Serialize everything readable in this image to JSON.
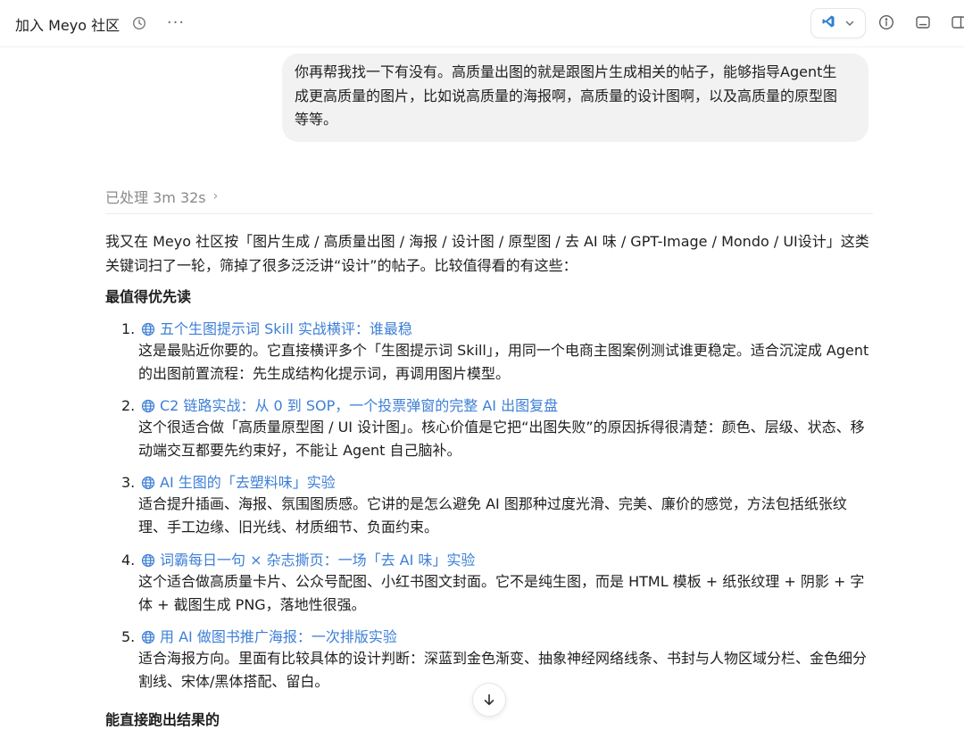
{
  "header": {
    "title": "加入 Meyo 社区",
    "more_label": "···",
    "history_icon": "clock-icon",
    "ide_icon": "vscode-icon"
  },
  "user_message": "你再帮我找一下有没有。高质量出图的就是跟图片生成相关的帖子，能够指导Agent生成更高质量的图片，比如说高质量的海报啊，高质量的设计图啊，以及高质量的原型图等等。",
  "processed": {
    "label": "已处理 3m 32s",
    "chevron": "›"
  },
  "answer": {
    "intro": "我又在 Meyo 社区按「图片生成 / 高质量出图 / 海报 / 设计图 / 原型图 / 去 AI 味 / GPT-Image / Mondo / UI设计」这类关键词扫了一轮，筛掉了很多泛泛讲“设计”的帖子。比较值得看的有这些：",
    "section1": "最值得优先读",
    "items": [
      {
        "num": "1.",
        "title": "五个生图提示词 Skill 实战横评：谁最稳",
        "desc": "这是最贴近你要的。它直接横评多个「生图提示词 Skill」，用同一个电商主图案例测试谁更稳定。适合沉淀成 Agent 的出图前置流程：先生成结构化提示词，再调用图片模型。"
      },
      {
        "num": "2.",
        "title": "C2 链路实战：从 0 到 SOP，一个投票弹窗的完整 AI 出图复盘",
        "desc": "这个很适合做「高质量原型图 / UI 设计图」。核心价值是它把“出图失败”的原因拆得很清楚：颜色、层级、状态、移动端交互都要先约束好，不能让 Agent 自己脑补。"
      },
      {
        "num": "3.",
        "title": "AI 生图的「去塑料味」实验",
        "desc": "适合提升插画、海报、氛围图质感。它讲的是怎么避免 AI 图那种过度光滑、完美、廉价的感觉，方法包括纸张纹理、手工边缘、旧光线、材质细节、负面约束。"
      },
      {
        "num": "4.",
        "title": "词霸每日一句 × 杂志撕页：一场「去 AI 味」实验",
        "desc": "这个适合做高质量卡片、公众号配图、小红书图文封面。它不是纯生图，而是 HTML 模板 + 纸张纹理 + 阴影 + 字体 + 截图生成 PNG，落地性很强。"
      },
      {
        "num": "5.",
        "title": "用 AI 做图书推广海报：一次排版实验",
        "desc": "适合海报方向。里面有比较具体的设计判断：深蓝到金色渐变、抽象神经网络线条、书封与人物区域分栏、金色细分割线、宋体/黑体搭配、留白。"
      }
    ],
    "section2": "能直接跑出结果的"
  },
  "colors": {
    "link": "#3d7fd6",
    "bubble_bg": "#f2f2f2",
    "muted": "#8a8a8a"
  }
}
